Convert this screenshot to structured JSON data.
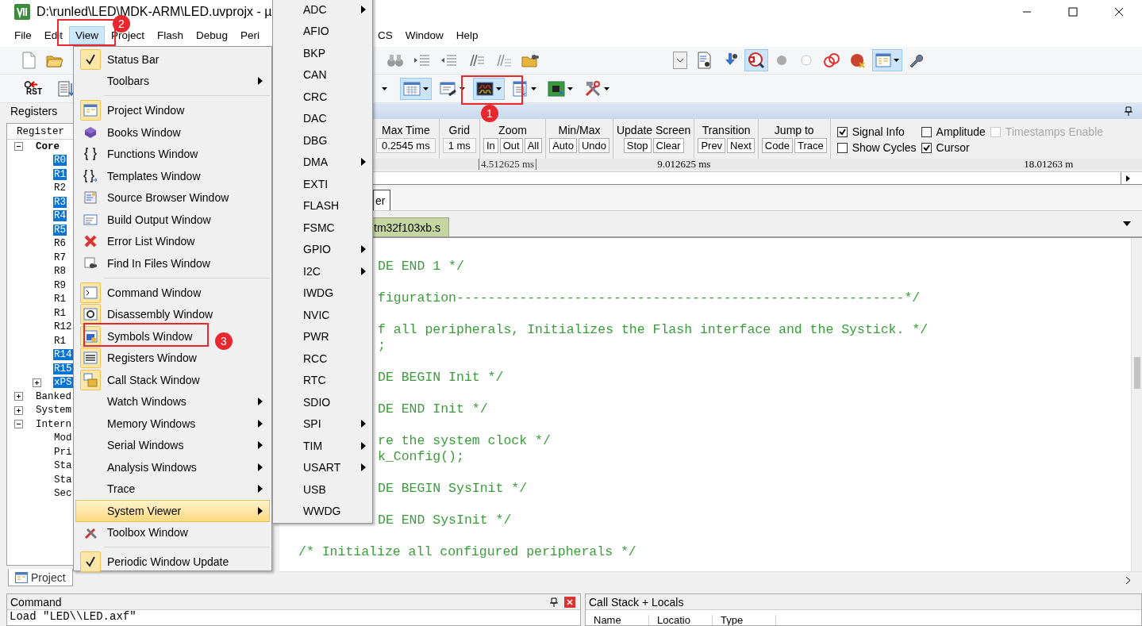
{
  "window": {
    "title": "D:\\runled\\LED\\MDK-ARM\\LED.uvprojx - µ"
  },
  "menu_bar": {
    "left": [
      {
        "label": "File",
        "selected": false
      },
      {
        "label": "Edit",
        "selected": false
      },
      {
        "label": "View",
        "selected": true
      },
      {
        "label": "Project",
        "selected": false
      },
      {
        "label": "Flash",
        "selected": false
      },
      {
        "label": "Debug",
        "selected": false
      },
      {
        "label": "Peri",
        "selected": false
      }
    ],
    "right": [
      {
        "label": "CS",
        "selected": false
      },
      {
        "label": "Window",
        "selected": false
      },
      {
        "label": "Help",
        "selected": false
      }
    ]
  },
  "toolbar_1": {
    "groups": [
      [
        {
          "kind": "new-file",
          "selected": false
        },
        {
          "kind": "open-folder",
          "selected": false
        }
      ],
      [
        {
          "kind": "binoculars",
          "selected": false
        },
        {
          "kind": "indent",
          "selected": false
        },
        {
          "kind": "unindent",
          "selected": false
        },
        {
          "kind": "comment",
          "selected": false
        },
        {
          "kind": "uncomment",
          "selected": false
        },
        {
          "kind": "folder-search",
          "selected": false
        }
      ],
      [
        {
          "kind": "combo",
          "selected": false
        },
        {
          "kind": "doc-search",
          "selected": false
        },
        {
          "kind": "download",
          "selected": false
        },
        {
          "kind": "debug",
          "selected": true
        },
        {
          "kind": "dot",
          "selected": false
        },
        {
          "kind": "ring",
          "selected": false
        },
        {
          "kind": "rings",
          "selected": false
        },
        {
          "kind": "blob",
          "selected": false
        },
        {
          "kind": "window",
          "selected": true
        },
        {
          "kind": "wrench",
          "selected": false
        }
      ]
    ]
  },
  "toolbar_2": {
    "groups": [
      [
        {
          "kind": "reset",
          "label": "RST",
          "selected": false
        },
        {
          "kind": "list-down",
          "selected": false
        }
      ],
      [
        {
          "kind": "caret",
          "selected": false
        },
        {
          "kind": "grid-window",
          "selected": true
        },
        {
          "kind": "pen-window",
          "selected": false
        },
        {
          "kind": "analyzer",
          "selected": true
        },
        {
          "kind": "trace-list",
          "selected": false
        },
        {
          "kind": "board",
          "selected": false
        },
        {
          "kind": "tools",
          "selected": false
        }
      ]
    ]
  },
  "registers": {
    "title": "Registers",
    "column": "Register",
    "tree": [
      {
        "label": "Core",
        "bold": true,
        "highlighted": false,
        "expanded": true,
        "children": [
          {
            "label": "R0",
            "bold": false,
            "highlighted": true
          },
          {
            "label": "R1",
            "bold": false,
            "highlighted": true
          },
          {
            "label": "R2",
            "bold": false,
            "highlighted": false
          },
          {
            "label": "R3",
            "bold": false,
            "highlighted": true
          },
          {
            "label": "R4",
            "bold": false,
            "highlighted": true
          },
          {
            "label": "R5",
            "bold": false,
            "highlighted": true
          },
          {
            "label": "R6",
            "bold": false,
            "highlighted": false
          },
          {
            "label": "R7",
            "bold": false,
            "highlighted": false
          },
          {
            "label": "R8",
            "bold": false,
            "highlighted": false
          },
          {
            "label": "R9",
            "bold": false,
            "highlighted": false
          },
          {
            "label": "R1",
            "bold": false,
            "highlighted": false
          },
          {
            "label": "R1",
            "bold": false,
            "highlighted": false
          },
          {
            "label": "R12",
            "bold": false,
            "highlighted": false
          },
          {
            "label": "R1",
            "bold": false,
            "highlighted": false
          },
          {
            "label": "R14",
            "bold": false,
            "highlighted": true
          },
          {
            "label": "R15",
            "bold": false,
            "highlighted": true
          },
          {
            "label": "xPS",
            "bold": false,
            "highlighted": true,
            "expanded": false
          }
        ]
      },
      {
        "label": "Banked",
        "bold": false,
        "highlighted": false,
        "expanded": false
      },
      {
        "label": "System",
        "bold": false,
        "highlighted": false,
        "expanded": false
      },
      {
        "label": "Intern",
        "bold": false,
        "highlighted": false,
        "expanded": true,
        "children": [
          {
            "label": "Mod",
            "bold": false,
            "highlighted": false
          },
          {
            "label": "Pri",
            "bold": false,
            "highlighted": false
          },
          {
            "label": "Sta",
            "bold": false,
            "highlighted": false
          },
          {
            "label": "Sta",
            "bold": false,
            "highlighted": false
          },
          {
            "label": "Sec",
            "bold": false,
            "highlighted": false
          }
        ]
      }
    ]
  },
  "logic_analyzer": {
    "groups": [
      {
        "kind": "readout",
        "title": "Max Time",
        "value": "0.2545 ms"
      },
      {
        "kind": "readout",
        "title": "Grid",
        "value": "1 ms"
      },
      {
        "kind": "buttons",
        "title": "Zoom",
        "buttons": [
          "In",
          "Out",
          "All"
        ]
      },
      {
        "kind": "buttons",
        "title": "Min/Max",
        "buttons": [
          "Auto",
          "Undo"
        ]
      },
      {
        "kind": "buttons",
        "title": "Update Screen",
        "buttons": [
          "Stop",
          "Clear"
        ]
      },
      {
        "kind": "buttons",
        "title": "Transition",
        "buttons": [
          "Prev",
          "Next"
        ]
      },
      {
        "kind": "buttons",
        "title": "Jump to",
        "buttons": [
          "Code",
          "Trace"
        ]
      }
    ],
    "options": [
      {
        "label": "Signal Info",
        "checked": true,
        "disabled": false
      },
      {
        "label": "Show Cycles",
        "checked": false,
        "disabled": false
      },
      {
        "label": "Amplitude",
        "checked": false,
        "disabled": false
      },
      {
        "label": "Cursor",
        "checked": true,
        "disabled": false
      },
      {
        "label": "Timestamps Enable",
        "checked": false,
        "disabled": true
      }
    ],
    "axis_labels": [
      {
        "text": "4.512625 ms",
        "kind": "cursor"
      },
      {
        "text": "9.012625 ms",
        "kind": "plain"
      },
      {
        "text": "18.01263 m",
        "kind": "plain"
      }
    ]
  },
  "panel_tabs": [
    {
      "label": "er",
      "selected": true
    }
  ],
  "editor_tabs": [
    {
      "label": "tm32f103xb.s",
      "selected": true
    }
  ],
  "editor": {
    "lines": [
      {
        "kind": "code",
        "text": "DE END 1 */"
      },
      {
        "kind": "blank"
      },
      {
        "kind": "code",
        "text": "figuration---------------------------------------------------------*/"
      },
      {
        "kind": "blank"
      },
      {
        "kind": "code",
        "text": "f all peripherals, Initializes the Flash interface and the Systick. */"
      },
      {
        "kind": "code",
        "text": ";"
      },
      {
        "kind": "blank"
      },
      {
        "kind": "code",
        "text": "DE BEGIN Init */"
      },
      {
        "kind": "blank"
      },
      {
        "kind": "code",
        "text": "DE END Init */"
      },
      {
        "kind": "blank"
      },
      {
        "kind": "code",
        "text": "re the system clock */"
      },
      {
        "kind": "code",
        "text": "k_Config();"
      },
      {
        "kind": "blank"
      },
      {
        "kind": "code",
        "text": "DE BEGIN SysInit */"
      },
      {
        "kind": "blank"
      },
      {
        "kind": "code",
        "text": "DE END SysInit */"
      },
      {
        "kind": "blank"
      },
      {
        "kind": "full",
        "text": "/* Initialize all configured peripherals */"
      }
    ]
  },
  "bottom_tabs": [
    {
      "label": "Project",
      "selected": true
    }
  ],
  "command": {
    "title": "Command",
    "lines": [
      "Load \"LED\\\\LED.axf\""
    ]
  },
  "call_stack": {
    "title": "Call Stack + Locals",
    "columns": [
      "Name",
      "Locatio",
      "Type"
    ]
  },
  "view_menu": {
    "items": [
      {
        "kind": "item",
        "label": "Status Bar",
        "checked": true,
        "submenu": false,
        "selected": false
      },
      {
        "kind": "item",
        "label": "Toolbars",
        "checked": false,
        "submenu": true,
        "selected": false
      },
      {
        "kind": "separator"
      },
      {
        "kind": "item",
        "label": "Project Window",
        "checked": true,
        "submenu": false,
        "selected": false
      },
      {
        "kind": "item",
        "label": "Books Window",
        "checked": false,
        "submenu": false,
        "selected": false
      },
      {
        "kind": "item",
        "label": "Functions Window",
        "checked": false,
        "submenu": false,
        "selected": false
      },
      {
        "kind": "item",
        "label": "Templates Window",
        "checked": false,
        "submenu": false,
        "selected": false
      },
      {
        "kind": "item",
        "label": "Source Browser Window",
        "checked": false,
        "submenu": false,
        "selected": false
      },
      {
        "kind": "item",
        "label": "Build Output Window",
        "checked": false,
        "submenu": false,
        "selected": false
      },
      {
        "kind": "item",
        "label": "Error List Window",
        "checked": false,
        "submenu": false,
        "selected": false
      },
      {
        "kind": "item",
        "label": "Find In Files Window",
        "checked": false,
        "submenu": false,
        "selected": false
      },
      {
        "kind": "separator"
      },
      {
        "kind": "item",
        "label": "Command Window",
        "checked": true,
        "submenu": false,
        "selected": false
      },
      {
        "kind": "item",
        "label": "Disassembly Window",
        "checked": true,
        "submenu": false,
        "selected": false
      },
      {
        "kind": "item",
        "label": "Symbols Window",
        "checked": true,
        "submenu": false,
        "selected": false
      },
      {
        "kind": "item",
        "label": "Registers Window",
        "checked": true,
        "submenu": false,
        "selected": false
      },
      {
        "kind": "item",
        "label": "Call Stack Window",
        "checked": true,
        "submenu": false,
        "selected": false
      },
      {
        "kind": "item",
        "label": "Watch Windows",
        "checked": false,
        "submenu": true,
        "selected": false
      },
      {
        "kind": "item",
        "label": "Memory Windows",
        "checked": false,
        "submenu": true,
        "selected": false
      },
      {
        "kind": "item",
        "label": "Serial Windows",
        "checked": false,
        "submenu": true,
        "selected": false
      },
      {
        "kind": "item",
        "label": "Analysis Windows",
        "checked": false,
        "submenu": true,
        "selected": false
      },
      {
        "kind": "item",
        "label": "Trace",
        "checked": false,
        "submenu": true,
        "selected": false
      },
      {
        "kind": "item",
        "label": "System Viewer",
        "checked": false,
        "submenu": true,
        "selected": true
      },
      {
        "kind": "item",
        "label": "Toolbox Window",
        "checked": false,
        "submenu": false,
        "selected": false
      },
      {
        "kind": "separator"
      },
      {
        "kind": "item",
        "label": "Periodic Window Update",
        "checked": true,
        "submenu": false,
        "selected": false
      }
    ]
  },
  "system_viewer_menu": {
    "items": [
      {
        "label": "ADC",
        "submenu": true
      },
      {
        "label": "AFIO",
        "submenu": false
      },
      {
        "label": "BKP",
        "submenu": false
      },
      {
        "label": "CAN",
        "submenu": false
      },
      {
        "label": "CRC",
        "submenu": false
      },
      {
        "label": "DAC",
        "submenu": false
      },
      {
        "label": "DBG",
        "submenu": false
      },
      {
        "label": "DMA",
        "submenu": true
      },
      {
        "label": "EXTI",
        "submenu": false
      },
      {
        "label": "FLASH",
        "submenu": false
      },
      {
        "label": "FSMC",
        "submenu": false
      },
      {
        "label": "GPIO",
        "submenu": true
      },
      {
        "label": "I2C",
        "submenu": true
      },
      {
        "label": "IWDG",
        "submenu": false
      },
      {
        "label": "NVIC",
        "submenu": false
      },
      {
        "label": "PWR",
        "submenu": false
      },
      {
        "label": "RCC",
        "submenu": false
      },
      {
        "label": "RTC",
        "submenu": false
      },
      {
        "label": "SDIO",
        "submenu": false
      },
      {
        "label": "SPI",
        "submenu": true
      },
      {
        "label": "TIM",
        "submenu": true
      },
      {
        "label": "USART",
        "submenu": true
      },
      {
        "label": "USB",
        "submenu": false
      },
      {
        "label": "WWDG",
        "submenu": false
      }
    ]
  },
  "annotations": [
    {
      "label": "1"
    },
    {
      "label": "2"
    },
    {
      "label": "3"
    }
  ]
}
